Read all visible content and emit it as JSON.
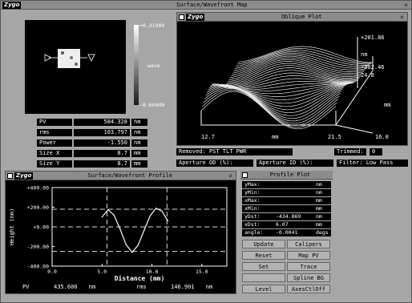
{
  "app": {
    "logo": "Zygo",
    "title": "Surface/Wavefront Map"
  },
  "map_panel": {
    "scale_max": "+0.31900",
    "scale_min": "-0.60440",
    "scale_unit": "wave"
  },
  "stats": [
    {
      "label": "PV",
      "value": "584.328",
      "unit": "nm"
    },
    {
      "label": "rms",
      "value": "103.797",
      "unit": "nm"
    },
    {
      "label": "Power",
      "value": "-1.550",
      "unit": "nm"
    },
    {
      "label": "Size X",
      "value": "8.7",
      "unit": "mm"
    },
    {
      "label": "Size Y",
      "value": "8.7",
      "unit": "mm"
    }
  ],
  "oblique": {
    "logo": "Zygo",
    "title": "Oblique Plot",
    "z_top": "+201.86",
    "z_unit": "nm",
    "z_bottom": "-382.46",
    "y_max": "24.8",
    "y_unit": "mm",
    "y_min": "16.0",
    "x_min": "12.7",
    "x_unit": "mm",
    "x_max": "21.5"
  },
  "status": {
    "removed": "Removed: PST TLT PWR",
    "trimmed_label": "Trimmed:",
    "trimmed_value": "0",
    "aperture_od": "Aperture OD (%):",
    "aperture_id": "Aperture ID (%):",
    "filter": "Filter:  Low Pass"
  },
  "profile": {
    "logo": "Zygo",
    "title": "Surface/Wavefront Profile",
    "pv_label": "PV",
    "pv_value": "435.600",
    "pv_unit": "nm",
    "rms_label": "rms",
    "rms_value": "146.901",
    "rms_unit": "nm"
  },
  "profile_plot": {
    "title": "Profile Plot",
    "rows": [
      {
        "label": "yMax:",
        "value": "",
        "unit": "nm"
      },
      {
        "label": "yMin:",
        "value": "",
        "unit": "nm"
      },
      {
        "label": "xMax:",
        "value": "",
        "unit": "mm"
      },
      {
        "label": "xMin:",
        "value": "",
        "unit": "mm"
      },
      {
        "label": "yDst:",
        "value": "-434.869",
        "unit": "nm"
      },
      {
        "label": "xDst:",
        "value": "6.07",
        "unit": "mm"
      },
      {
        "label": "angle:",
        "value": "-0.0041",
        "unit": "degs"
      }
    ],
    "buttons": [
      "Update",
      "Calipers",
      "Reset",
      "Map PV",
      "Set",
      "Trace",
      "",
      "Spline BG",
      "Level",
      "AxesCtlOff"
    ]
  },
  "chart_data": {
    "type": "line",
    "xlabel": "Distance (mm)",
    "ylabel": "Height (nm)",
    "xlim": [
      0,
      17.5
    ],
    "ylim": [
      -400,
      400
    ],
    "x_ticks": [
      "0.0",
      "5.0",
      "10.0",
      "15.0"
    ],
    "y_ticks": [
      "+400.00",
      "+200.00",
      "+0.00",
      "-200.00",
      "-400.00"
    ],
    "series": [
      {
        "x": [
          5.0,
          5.6,
          6.2,
          6.8,
          7.4,
          8.0,
          8.6,
          9.2,
          9.8,
          10.4,
          11.0,
          11.6
        ],
        "values": [
          100,
          175,
          120,
          -20,
          -180,
          -260,
          -190,
          -40,
          110,
          190,
          160,
          60
        ]
      }
    ],
    "cursor_x": [
      5.5,
      11.5
    ],
    "ref_lines_y": [
      180,
      0,
      -250
    ]
  }
}
